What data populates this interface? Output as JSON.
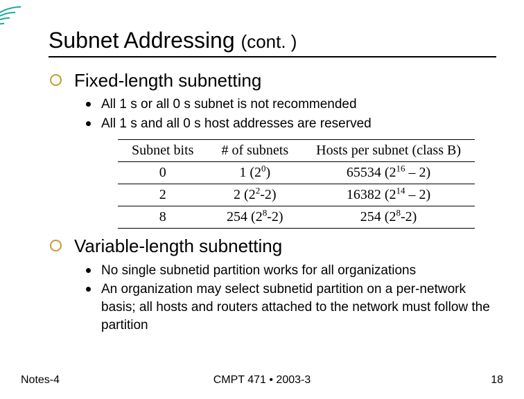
{
  "title_main": "Subnet Addressing ",
  "title_cont": "(cont. )",
  "section1": {
    "heading": "Fixed-length subnetting",
    "bullets": [
      "All 1 s or all 0 s subnet is not recommended",
      "All 1 s and all 0 s host addresses are reserved"
    ]
  },
  "chart_data": {
    "type": "table",
    "columns": [
      "Subnet bits",
      "# of subnets",
      "Hosts per subnet (class B)"
    ],
    "rows": [
      {
        "subnet_bits": "0",
        "num_subnets": "1 (2^0)",
        "hosts": "65534 (2^16 – 2)"
      },
      {
        "subnet_bits": "2",
        "num_subnets": "2 (2^2-2)",
        "hosts": "16382 (2^14 – 2)"
      },
      {
        "subnet_bits": "8",
        "num_subnets": "254 (2^8-2)",
        "hosts": "254 (2^8-2)"
      }
    ]
  },
  "table": {
    "headers": [
      "Subnet bits",
      "# of subnets",
      "Hosts per subnet (class B)"
    ],
    "rows": [
      {
        "c0": "0",
        "c1_a": "1 (2",
        "c1_sup": "0",
        "c1_b": ")",
        "c2_a": "65534 (2",
        "c2_sup": "16",
        "c2_b": " – 2)"
      },
      {
        "c0": "2",
        "c1_a": "2 (2",
        "c1_sup": "2",
        "c1_b": "-2)",
        "c2_a": "16382 (2",
        "c2_sup": "14",
        "c2_b": " – 2)"
      },
      {
        "c0": "8",
        "c1_a": "254 (2",
        "c1_sup": "8",
        "c1_b": "-2)",
        "c2_a": "254 (2",
        "c2_sup": "8",
        "c2_b": "-2)"
      }
    ]
  },
  "section2": {
    "heading": "Variable-length subnetting",
    "bullets": [
      "No single subnetid partition works for all organizations",
      "An organization may select subnetid partition on a per-network basis; all hosts and routers attached to the network must follow the partition"
    ]
  },
  "footer": {
    "left": "Notes-4",
    "center": "CMPT 471 • 2003-3",
    "right": "18"
  }
}
